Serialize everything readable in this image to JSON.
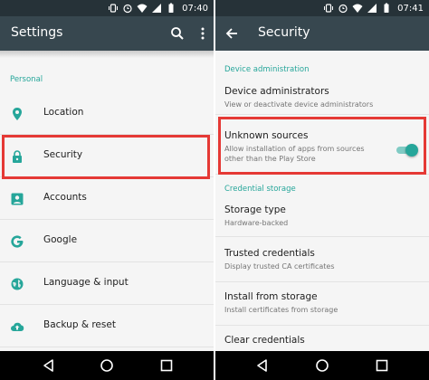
{
  "left": {
    "status": {
      "time": "07:40"
    },
    "toolbar": {
      "title": "Settings",
      "search_icon": "search-icon",
      "menu_icon": "more-vert-icon"
    },
    "section_header": "Personal",
    "items": [
      {
        "label": "Location",
        "icon": "location-pin-icon"
      },
      {
        "label": "Security",
        "icon": "lock-icon"
      },
      {
        "label": "Accounts",
        "icon": "account-box-icon"
      },
      {
        "label": "Google",
        "icon": "google-g-icon"
      },
      {
        "label": "Language & input",
        "icon": "globe-icon"
      },
      {
        "label": "Backup & reset",
        "icon": "cloud-upload-icon"
      }
    ]
  },
  "right": {
    "status": {
      "time": "07:41"
    },
    "toolbar": {
      "title": "Security",
      "back_icon": "arrow-back-icon"
    },
    "sections": [
      {
        "header": "Device administration"
      },
      {
        "header": "Credential storage"
      }
    ],
    "items": [
      {
        "title": "Device administrators",
        "summary": "View or deactivate device administrators"
      },
      {
        "title": "Unknown sources",
        "summary": "Allow installation of apps from sources other than the Play Store",
        "toggle_on": true
      },
      {
        "title": "Storage type",
        "summary": "Hardware-backed"
      },
      {
        "title": "Trusted credentials",
        "summary": "Display trusted CA certificates"
      },
      {
        "title": "Install from storage",
        "summary": "Install certificates from storage"
      },
      {
        "title": "Clear credentials",
        "summary": ""
      }
    ]
  },
  "colors": {
    "status_bar": "#263238",
    "toolbar": "#37474f",
    "accent": "#26a69a",
    "highlight": "#e53935",
    "navbar": "#000000"
  },
  "navbar": {
    "back_icon": "nav-back-icon",
    "home_icon": "nav-home-icon",
    "recents_icon": "nav-recents-icon"
  }
}
